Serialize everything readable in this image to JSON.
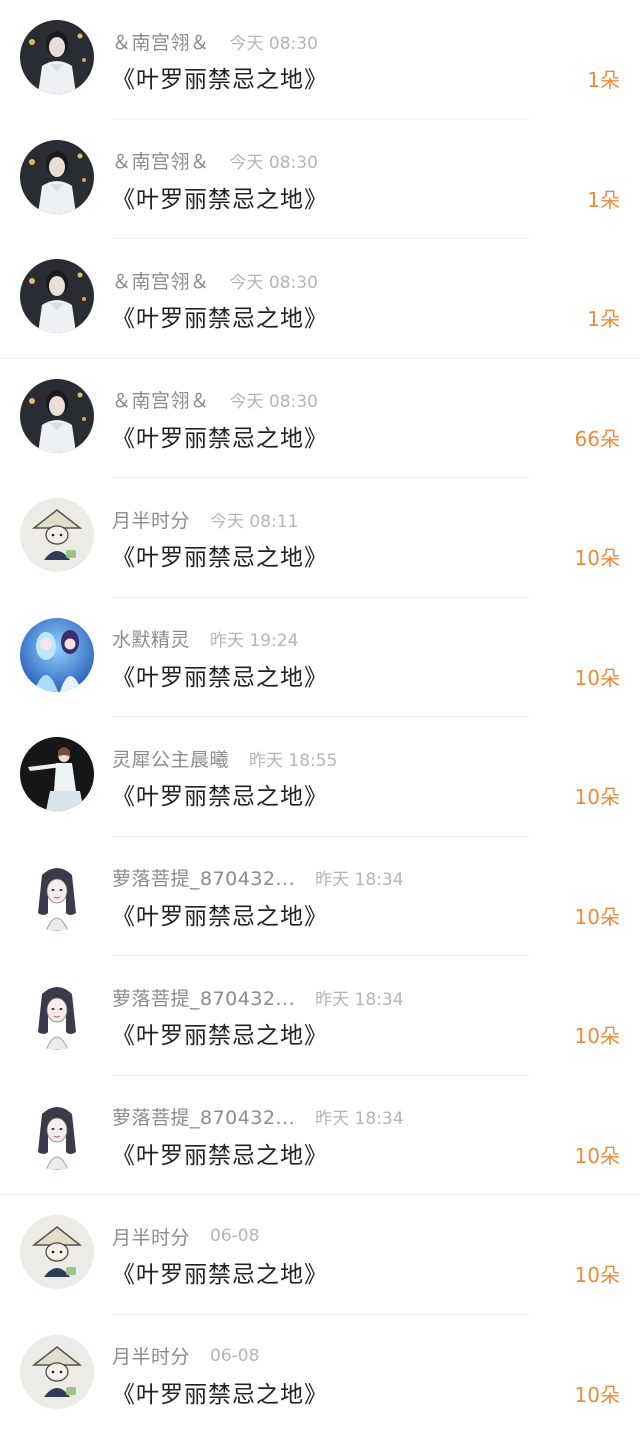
{
  "gifts": [
    {
      "user": "＆南宫翎＆",
      "time": "今天 08:30",
      "title": "《叶罗丽禁忌之地》",
      "count": "1朵",
      "avatar": "dark-portrait-avatar"
    },
    {
      "user": "＆南宫翎＆",
      "time": "今天 08:30",
      "title": "《叶罗丽禁忌之地》",
      "count": "1朵",
      "avatar": "dark-portrait-avatar"
    },
    {
      "user": "＆南宫翎＆",
      "time": "今天 08:30",
      "title": "《叶罗丽禁忌之地》",
      "count": "1朵",
      "avatar": "dark-portrait-avatar"
    },
    {
      "user": "＆南宫翎＆",
      "time": "今天 08:30",
      "title": "《叶罗丽禁忌之地》",
      "count": "66朵",
      "avatar": "dark-portrait-avatar"
    },
    {
      "user": "月半时分",
      "time": "今天 08:11",
      "title": "《叶罗丽禁忌之地》",
      "count": "10朵",
      "avatar": "straw-hat-cartoon-avatar"
    },
    {
      "user": "水默精灵",
      "time": "昨天 19:24",
      "title": "《叶罗丽禁忌之地》",
      "count": "10朵",
      "avatar": "blue-fairy-avatar"
    },
    {
      "user": "灵犀公主晨曦",
      "time": "昨天 18:55",
      "title": "《叶罗丽禁忌之地》",
      "count": "10朵",
      "avatar": "dancer-avatar"
    },
    {
      "user": "萝落菩提_870432...",
      "time": "昨天 18:34",
      "title": "《叶罗丽禁忌之地》",
      "count": "10朵",
      "avatar": "sketch-girl-avatar"
    },
    {
      "user": "萝落菩提_870432...",
      "time": "昨天 18:34",
      "title": "《叶罗丽禁忌之地》",
      "count": "10朵",
      "avatar": "sketch-girl-avatar"
    },
    {
      "user": "萝落菩提_870432...",
      "time": "昨天 18:34",
      "title": "《叶罗丽禁忌之地》",
      "count": "10朵",
      "avatar": "sketch-girl-avatar"
    },
    {
      "user": "月半时分",
      "time": "06-08",
      "title": "《叶罗丽禁忌之地》",
      "count": "10朵",
      "avatar": "straw-hat-cartoon-avatar"
    },
    {
      "user": "月半时分",
      "time": "06-08",
      "title": "《叶罗丽禁忌之地》",
      "count": "10朵",
      "avatar": "straw-hat-cartoon-avatar"
    }
  ],
  "colors": {
    "count": "#f08a3a",
    "username": "#8c8c8c",
    "time": "#b5b5b5",
    "title": "#222222"
  }
}
